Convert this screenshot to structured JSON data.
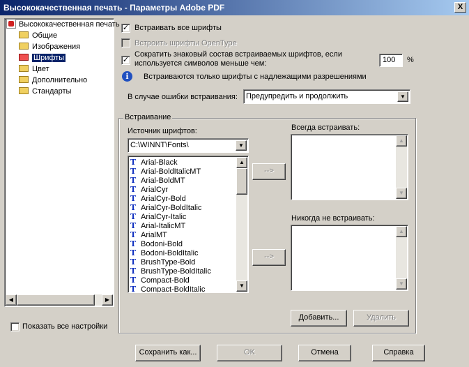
{
  "window": {
    "title": "Высококачественная печать - Параметры Adobe PDF",
    "close_label": "X"
  },
  "tree": {
    "root": "Высококачественная печать",
    "items": [
      "Общие",
      "Изображения",
      "Шрифты",
      "Цвет",
      "Дополнительно",
      "Стандарты"
    ],
    "selected_index": 2
  },
  "show_all_label": "Показать все настройки",
  "options": {
    "embed_all": "Встраивать все шрифты",
    "embed_opentype": "Встроить шрифты OpenType",
    "subset_line1": "Сократить знаковый состав встраиваемых шрифтов, если",
    "subset_line2": "используется символов меньше чем:",
    "subset_value": "100",
    "percent": "%",
    "info_text": "Встраиваются только шрифты с надлежащими разрешениями",
    "on_fail_label": "В случае ошибки встраивания:",
    "on_fail_value": "Предупредить и продолжить"
  },
  "embedding": {
    "group_title": "Встраивание",
    "source_label": "Источник шрифтов:",
    "source_value": "C:\\WINNT\\Fonts\\",
    "fonts": [
      "Arial-Black",
      "Arial-BoldItalicMT",
      "Arial-BoldMT",
      "ArialCyr",
      "ArialCyr-Bold",
      "ArialCyr-BoldItalic",
      "ArialCyr-Italic",
      "Arial-ItalicMT",
      "ArialMT",
      "Bodoni-Bold",
      "Bodoni-BoldItalic",
      "BrushType-Bold",
      "BrushType-BoldItalic",
      "Compact-Bold",
      "Compact-BoldItalic"
    ],
    "always_label": "Всегда встраивать:",
    "never_label": "Никогда не встраивать:",
    "move_always": "-->",
    "move_never": "-->",
    "add_button": "Добавить...",
    "remove_button": "Удалить"
  },
  "footer": {
    "save_as": "Сохранить как...",
    "ok": "OK",
    "cancel": "Отмена",
    "help": "Справка"
  }
}
